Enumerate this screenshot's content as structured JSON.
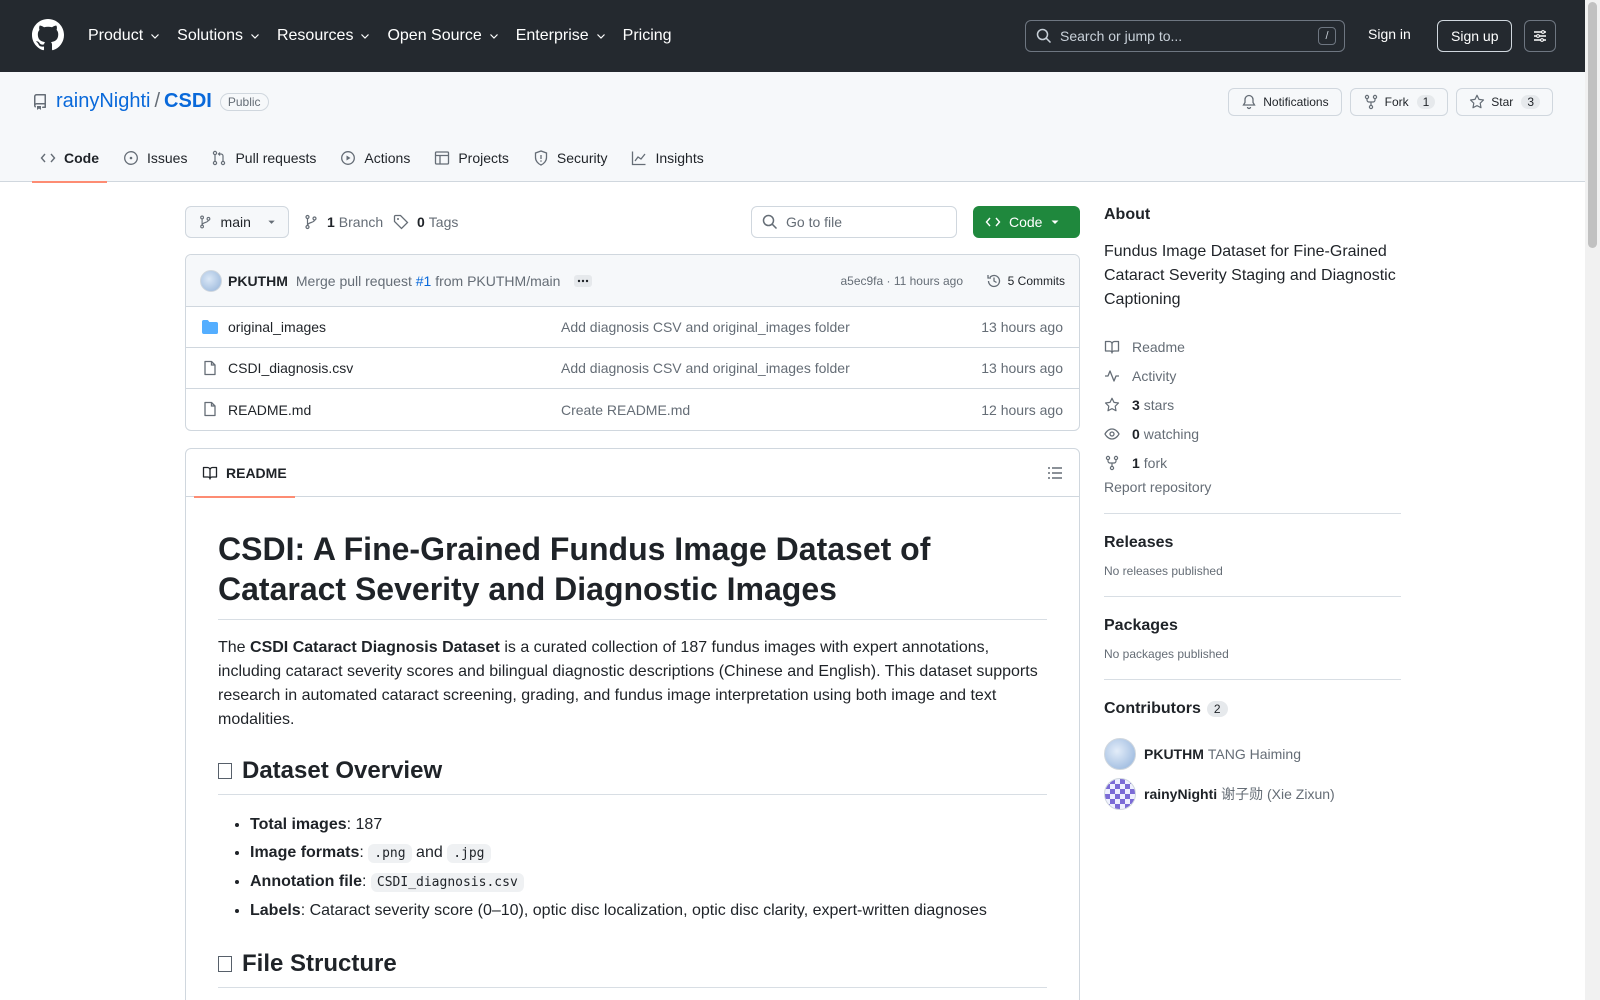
{
  "header": {
    "nav": [
      "Product",
      "Solutions",
      "Resources",
      "Open Source",
      "Enterprise",
      "Pricing"
    ],
    "search_placeholder": "Search or jump to...",
    "search_shortcut": "/",
    "sign_in": "Sign in",
    "sign_up": "Sign up"
  },
  "repo": {
    "owner": "rainyNighti",
    "separator": "/",
    "name": "CSDI",
    "visibility": "Public",
    "notifications_label": "Notifications",
    "fork_label": "Fork",
    "fork_count": "1",
    "star_label": "Star",
    "star_count": "3",
    "tabs": [
      "Code",
      "Issues",
      "Pull requests",
      "Actions",
      "Projects",
      "Security",
      "Insights"
    ]
  },
  "toolbar": {
    "branch": "main",
    "branch_count": "1",
    "branch_label": "Branch",
    "tag_count": "0",
    "tag_label": "Tags",
    "goto_placeholder": "Go to file",
    "code_label": "Code"
  },
  "commit": {
    "author": "PKUTHM",
    "message_prefix": "Merge pull request",
    "pr_link": "#1",
    "message_suffix": "from PKUTHM/main",
    "hash_time": "a5ec9fa · 11 hours ago",
    "commits": "5 Commits"
  },
  "files": [
    {
      "name": "original_images",
      "type": "folder",
      "message": "Add diagnosis CSV and original_images folder",
      "time": "13 hours ago"
    },
    {
      "name": "CSDI_diagnosis.csv",
      "type": "file",
      "message": "Add diagnosis CSV and original_images folder",
      "time": "13 hours ago"
    },
    {
      "name": "README.md",
      "type": "file",
      "message": "Create README.md",
      "time": "12 hours ago"
    }
  ],
  "readme": {
    "tab": "README",
    "h1": "CSDI: A Fine-Grained Fundus Image Dataset of Cataract Severity and Diagnostic Images",
    "intro_prefix": "The ",
    "intro_bold": "CSDI Cataract Diagnosis Dataset",
    "intro_rest": " is a curated collection of 187 fundus images with expert annotations, including cataract severity scores and bilingual diagnostic descriptions (Chinese and English). This dataset supports research in automated cataract screening, grading, and fundus image interpretation using both image and text modalities.",
    "h2_overview": "Dataset Overview",
    "li1_label": "Total images",
    "li1_value": ": 187",
    "li2_label": "Image formats",
    "li2_sep": ":",
    "li2_code1": ".png",
    "li2_and": "and",
    "li2_code2": ".jpg",
    "li3_label": "Annotation file",
    "li3_sep": ":",
    "li3_code": "CSDI_diagnosis.csv",
    "li4_label": "Labels",
    "li4_value": ": Cataract severity score (0–10), optic disc localization, optic disc clarity, expert-written diagnoses",
    "h2_structure": "File Structure"
  },
  "about": {
    "title": "About",
    "description": "Fundus Image Dataset for Fine-Grained Cataract Severity Staging and Diagnostic Captioning",
    "readme": "Readme",
    "activity": "Activity",
    "stars_count": "3",
    "stars_label": "stars",
    "watching_count": "0",
    "watching_label": "watching",
    "fork_count": "1",
    "fork_label": "fork",
    "report": "Report repository"
  },
  "releases": {
    "title": "Releases",
    "empty": "No releases published"
  },
  "packages": {
    "title": "Packages",
    "empty": "No packages published"
  },
  "contributors": {
    "title": "Contributors",
    "count": "2",
    "items": [
      {
        "login": "PKUTHM",
        "name": "TANG Haiming"
      },
      {
        "login": "rainyNighti",
        "name": "谢子勋 (Xie Zixun)"
      }
    ]
  },
  "colors": {
    "accent": "#0969da",
    "green": "#1f883d",
    "header_bg": "#24292f",
    "tab_underline": "#fd8c73"
  }
}
